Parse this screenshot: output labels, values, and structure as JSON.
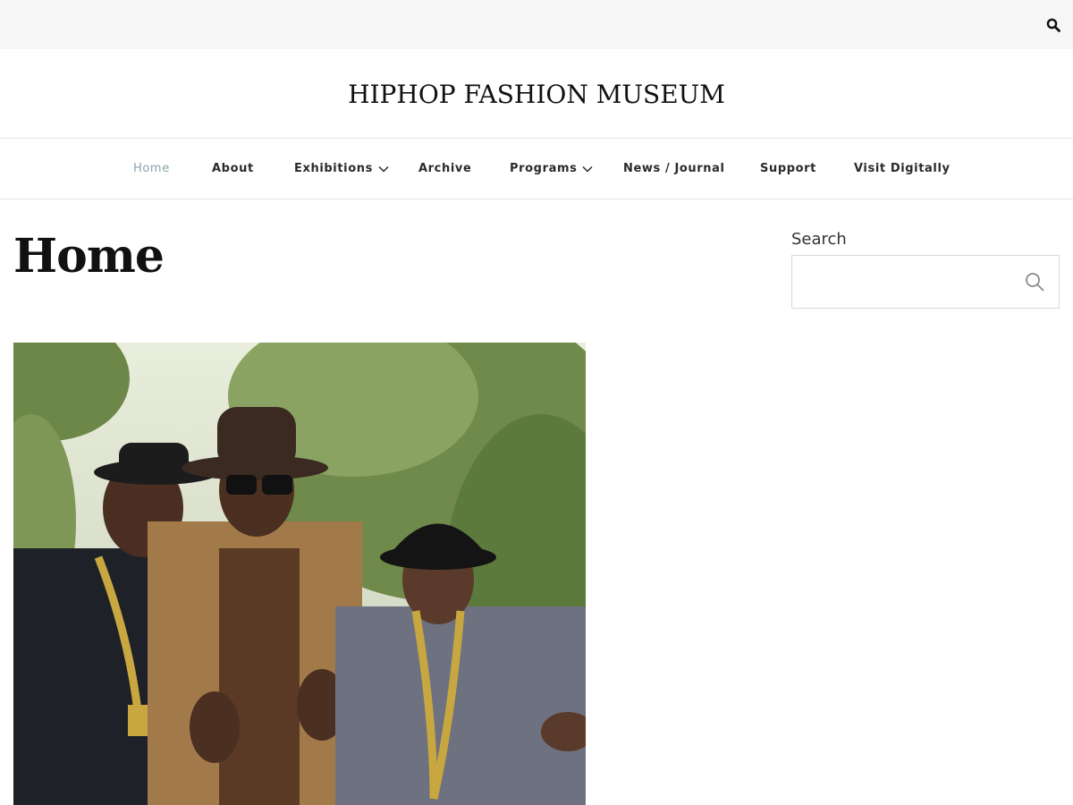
{
  "site": {
    "title": "HIPHOP FASHION MUSEUM"
  },
  "topbar": {
    "search_icon": "search-icon"
  },
  "nav": {
    "items": [
      {
        "label": "Home",
        "active": true,
        "has_dropdown": false
      },
      {
        "label": "About",
        "active": false,
        "has_dropdown": false
      },
      {
        "label": "Exhibitions",
        "active": false,
        "has_dropdown": true
      },
      {
        "label": "Archive",
        "active": false,
        "has_dropdown": false
      },
      {
        "label": "Programs",
        "active": false,
        "has_dropdown": true
      },
      {
        "label": "News / Journal",
        "active": false,
        "has_dropdown": false
      },
      {
        "label": "Support",
        "active": false,
        "has_dropdown": false
      },
      {
        "label": "Visit Digitally",
        "active": false,
        "has_dropdown": false
      }
    ]
  },
  "main": {
    "page_title": "Home"
  },
  "sidebar": {
    "search_label": "Search",
    "search_value": "",
    "search_placeholder": "",
    "search_button_icon": "search-icon"
  },
  "colors": {
    "topbar_bg": "#f6f6f6",
    "nav_active": "#8aa2ad",
    "text": "#1a1a1a",
    "border": "#e6e6e6"
  }
}
